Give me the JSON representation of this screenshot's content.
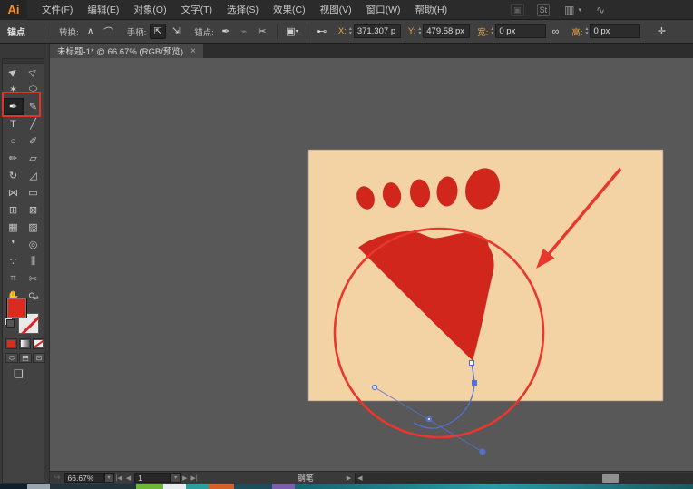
{
  "menu_bar": {
    "logo": "Ai",
    "items": [
      "文件(F)",
      "编辑(E)",
      "对象(O)",
      "文字(T)",
      "选择(S)",
      "效果(C)",
      "视图(V)",
      "窗口(W)",
      "帮助(H)"
    ],
    "right_icons": {
      "bridge": "▣",
      "stock": "St",
      "workspace": "▥",
      "workspace_arrow": "▾",
      "cs_live": "∿"
    }
  },
  "options_bar": {
    "mode_label": "锚点",
    "convert": {
      "label": "转换:",
      "corner_glyph": "∧",
      "smooth_glyph": "⌒"
    },
    "handles": {
      "label": "手柄:",
      "show_glyph": "⇱",
      "hide_glyph": "⇲"
    },
    "anchors": {
      "label": "锚点:",
      "delete_glyph": "✒",
      "connect_glyph": "⌁",
      "cut_glyph": "✂"
    },
    "isolate_glyph": "▣",
    "isolate_arrow": "▾",
    "connector_glyph": "⊷",
    "x_label": "X:",
    "x_value": "371.307 p",
    "y_label": "Y:",
    "y_value": "479.58 px",
    "w_label": "宽:",
    "w_value": "0 px",
    "h_label": "高:",
    "h_value": "0 px",
    "link_glyph": "∞",
    "end_glyph": "✛",
    "stepper_up": "▲",
    "stepper_down": "▼"
  },
  "document_tab": {
    "title": "未标题-1* @ 66.67% (RGB/预览)",
    "close": "×"
  },
  "toolbar": {
    "tools": [
      {
        "name": "selection-tool",
        "glyph": "▶"
      },
      {
        "name": "direct-selection-tool",
        "glyph": "▷"
      },
      {
        "name": "magic-wand-tool",
        "glyph": "✶"
      },
      {
        "name": "lasso-tool",
        "glyph": "⬭"
      },
      {
        "name": "pen-tool",
        "glyph": "✒",
        "selected": true
      },
      {
        "name": "curvature-tool",
        "glyph": "✎"
      },
      {
        "name": "type-tool",
        "glyph": "T"
      },
      {
        "name": "line-segment-tool",
        "glyph": "╱"
      },
      {
        "name": "ellipse-tool",
        "glyph": "○"
      },
      {
        "name": "paintbrush-tool",
        "glyph": "✐"
      },
      {
        "name": "pencil-tool",
        "glyph": "✏"
      },
      {
        "name": "eraser-tool",
        "glyph": "▱"
      },
      {
        "name": "rotate-tool",
        "glyph": "↻"
      },
      {
        "name": "scale-tool",
        "glyph": "◿"
      },
      {
        "name": "width-tool",
        "glyph": "⋈"
      },
      {
        "name": "free-transform-tool",
        "glyph": "▭"
      },
      {
        "name": "shape-builder-tool",
        "glyph": "⊞"
      },
      {
        "name": "perspective-grid-tool",
        "glyph": "⊠"
      },
      {
        "name": "mesh-tool",
        "glyph": "▦"
      },
      {
        "name": "gradient-tool",
        "glyph": "▨"
      },
      {
        "name": "eyedropper-tool",
        "glyph": "❜"
      },
      {
        "name": "blend-tool",
        "glyph": "◎"
      },
      {
        "name": "symbol-sprayer-tool",
        "glyph": "∵"
      },
      {
        "name": "column-graph-tool",
        "glyph": "⫼"
      },
      {
        "name": "artboard-tool",
        "glyph": "⌗"
      },
      {
        "name": "slice-tool",
        "glyph": "✂"
      },
      {
        "name": "hand-tool",
        "glyph": "✋"
      },
      {
        "name": "zoom-tool",
        "glyph": "⚲"
      }
    ],
    "swap_glyph": "⇄",
    "draw_modes": [
      "⬭",
      "⬒",
      "⊡"
    ],
    "screen_mode_glyph": "❏"
  },
  "status_bar": {
    "status_icon": "↪",
    "zoom_value": "66.67%",
    "first_glyph": "|◀",
    "prev_glyph": "◀",
    "artboard_value": "1",
    "next_glyph": "▶",
    "last_glyph": "▶|",
    "tool_name": "钢笔",
    "pane_arrow": "▶",
    "scroll_left_glyph": "◀",
    "dropdown_glyph": "▾"
  },
  "canvas": {
    "artboard_color": "#f3d2a4",
    "artwork_red": "#d0261c",
    "annotation_red": "#e8372c",
    "path_blue": "#5570cf",
    "fill_swatch_color": "#dd2a1e"
  }
}
